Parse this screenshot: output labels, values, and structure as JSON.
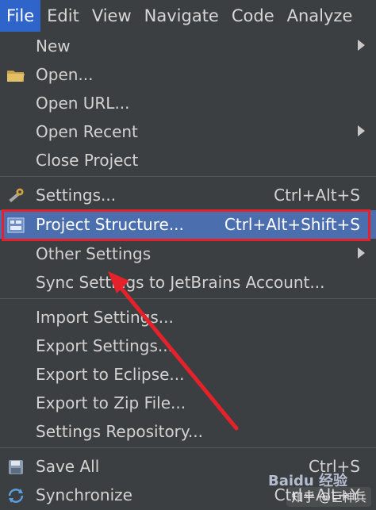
{
  "menubar": {
    "items": [
      "File",
      "Edit",
      "View",
      "Navigate",
      "Code",
      "Analyze"
    ]
  },
  "file_menu": {
    "items": [
      {
        "label": "New",
        "shortcut": "",
        "submenu": true,
        "icon": ""
      },
      {
        "label": "Open...",
        "shortcut": "",
        "submenu": false,
        "icon": "folder-icon"
      },
      {
        "label": "Open URL...",
        "shortcut": "",
        "submenu": false,
        "icon": ""
      },
      {
        "label": "Open Recent",
        "shortcut": "",
        "submenu": true,
        "icon": ""
      },
      {
        "label": "Close Project",
        "shortcut": "",
        "submenu": false,
        "icon": ""
      },
      {
        "label": "Settings...",
        "shortcut": "Ctrl+Alt+S",
        "submenu": false,
        "icon": "wrench-icon"
      },
      {
        "label": "Project Structure...",
        "shortcut": "Ctrl+Alt+Shift+S",
        "submenu": false,
        "icon": "project-structure-icon",
        "selected": true
      },
      {
        "label": "Other Settings",
        "shortcut": "",
        "submenu": true,
        "icon": ""
      },
      {
        "label": "Sync Settings to JetBrains Account...",
        "shortcut": "",
        "submenu": false,
        "icon": ""
      },
      {
        "label": "Import Settings...",
        "shortcut": "",
        "submenu": false,
        "icon": ""
      },
      {
        "label": "Export Settings...",
        "shortcut": "",
        "submenu": false,
        "icon": ""
      },
      {
        "label": "Export to Eclipse...",
        "shortcut": "",
        "submenu": false,
        "icon": ""
      },
      {
        "label": "Export to Zip File...",
        "shortcut": "",
        "submenu": false,
        "icon": ""
      },
      {
        "label": "Settings Repository...",
        "shortcut": "",
        "submenu": false,
        "icon": ""
      },
      {
        "label": "Save All",
        "shortcut": "Ctrl+S",
        "submenu": false,
        "icon": "save-icon"
      },
      {
        "label": "Synchronize",
        "shortcut": "Ctrl+Alt+Y",
        "submenu": false,
        "icon": "sync-icon"
      }
    ]
  },
  "watermark": {
    "baidu": "Baidu 经验",
    "zhihu": "知乎 @巨神兵"
  },
  "colors": {
    "menu_bg": "#3c3f41",
    "active_menu": "#2f65ca",
    "selected_item": "#4b6eaf",
    "annotation": "#e5222b"
  }
}
